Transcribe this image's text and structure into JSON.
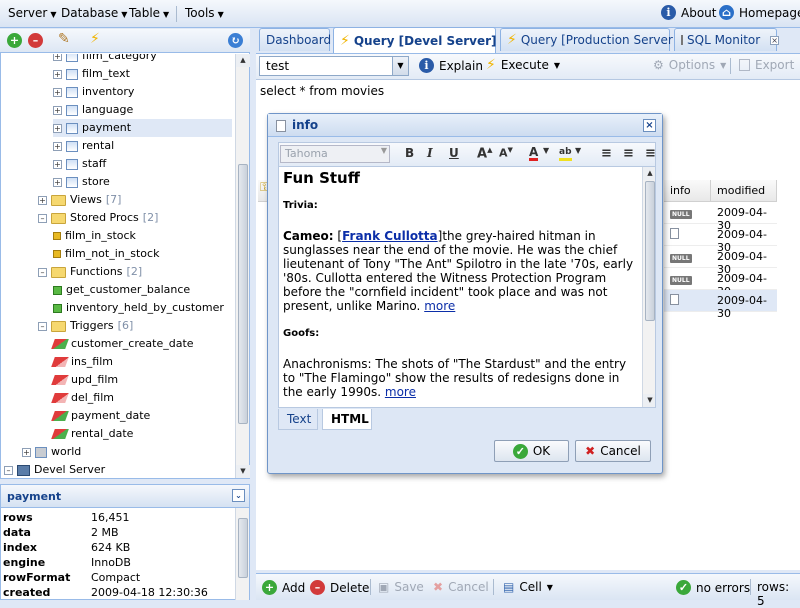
{
  "menubar": {
    "items": [
      "Server",
      "Database",
      "Table",
      "Tools"
    ],
    "about": "About",
    "homepage": "Homepage"
  },
  "tree": {
    "items": [
      {
        "label": "film_category",
        "kind": "table"
      },
      {
        "label": "film_text",
        "kind": "table"
      },
      {
        "label": "inventory",
        "kind": "table"
      },
      {
        "label": "language",
        "kind": "table"
      },
      {
        "label": "payment",
        "kind": "table",
        "selected": true
      },
      {
        "label": "rental",
        "kind": "table"
      },
      {
        "label": "staff",
        "kind": "table"
      },
      {
        "label": "store",
        "kind": "table"
      },
      {
        "label": "Views",
        "count": "[7]",
        "kind": "folder"
      },
      {
        "label": "Stored Procs",
        "count": "[2]",
        "kind": "folder"
      },
      {
        "label": "film_in_stock",
        "kind": "proc"
      },
      {
        "label": "film_not_in_stock",
        "kind": "proc"
      },
      {
        "label": "Functions",
        "count": "[2]",
        "kind": "folder"
      },
      {
        "label": "get_customer_balance",
        "kind": "func"
      },
      {
        "label": "inventory_held_by_customer",
        "kind": "func"
      },
      {
        "label": "Triggers",
        "count": "[6]",
        "kind": "folder"
      },
      {
        "label": "customer_create_date",
        "kind": "trig"
      },
      {
        "label": "ins_film",
        "kind": "trig-red"
      },
      {
        "label": "upd_film",
        "kind": "trig-red"
      },
      {
        "label": "del_film",
        "kind": "trig-red"
      },
      {
        "label": "payment_date",
        "kind": "trig"
      },
      {
        "label": "rental_date",
        "kind": "trig"
      },
      {
        "label": "world",
        "kind": "db"
      },
      {
        "label": "Devel Server",
        "kind": "server"
      }
    ]
  },
  "props": {
    "title": "payment",
    "rows": [
      {
        "k": "rows",
        "v": "16,451"
      },
      {
        "k": "data",
        "v": "2 MB"
      },
      {
        "k": "index",
        "v": "624 KB"
      },
      {
        "k": "engine",
        "v": "InnoDB"
      },
      {
        "k": "rowFormat",
        "v": "Compact"
      },
      {
        "k": "created",
        "v": "2009-04-18 12:30:36"
      }
    ]
  },
  "tabs": [
    {
      "label": "Dashboard"
    },
    {
      "label": "Query [Devel Server]",
      "active": true
    },
    {
      "label": "Query [Production Server]"
    },
    {
      "label": "SQL Monitor"
    }
  ],
  "query": {
    "selector": "test",
    "explain": "Explain",
    "execute": "Execute",
    "options": "Options",
    "export": "Export",
    "sql": "select * from movies"
  },
  "grid": {
    "headers": [
      "info",
      "modified"
    ],
    "rows": [
      {
        "info": "NULL",
        "modified": "2009-04-30"
      },
      {
        "info": "doc",
        "modified": "2009-04-30"
      },
      {
        "info": "NULL",
        "modified": "2009-04-30"
      },
      {
        "info": "NULL",
        "modified": "2009-04-30"
      },
      {
        "info": "doc",
        "modified": "2009-04-30",
        "selected": true
      }
    ]
  },
  "bottombar": {
    "add": "Add",
    "delete": "Delete",
    "save": "Save",
    "cancel": "Cancel",
    "cell": "Cell",
    "status": "no errors",
    "rows": "rows: 5"
  },
  "dialog": {
    "title": "info",
    "font": "Tahoma",
    "heading": "Fun Stuff",
    "trivia_label": "Trivia:",
    "cameo_label": "Cameo:",
    "cameo_link": "Frank Cullotta",
    "cameo_text": "the grey-haired hitman in sunglasses near the end of the movie. He was the chief lieutenant of Tony \"The Ant\" Spilotro in the late '70s, early '80s. Cullotta entered the Witness Protection Program before the \"cornfield incident\" took place and was not present, unlike Marino.",
    "more1": "more",
    "goofs_label": "Goofs:",
    "goofs_text": "Anachronisms: The shots of \"The Stardust\" and the entry to \"The Flamingo\" show the results of redesigns done in the early 1990s.",
    "more2": "more",
    "tab_text": "Text",
    "tab_html": "HTML",
    "ok": "OK",
    "cancel": "Cancel"
  }
}
